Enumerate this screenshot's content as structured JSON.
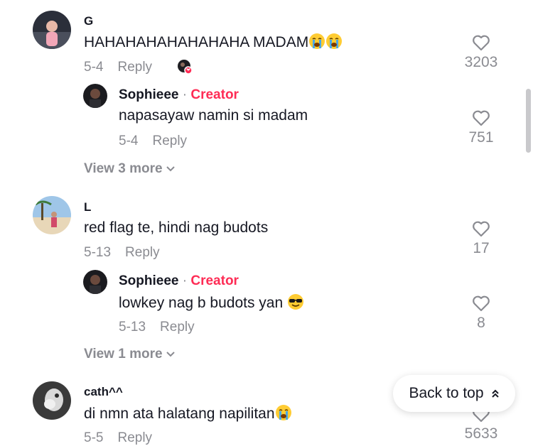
{
  "comments": [
    {
      "username": "G",
      "text": "HAHAHAHAHAHAHAHA MADAM",
      "date": "5-4",
      "reply_label": "Reply",
      "likes": "3203",
      "reply": {
        "username": "Sophieee",
        "separator": "·",
        "creator_label": "Creator",
        "text": "napasayaw namin si madam",
        "date": "5-4",
        "reply_label": "Reply",
        "likes": "751"
      },
      "more_label": "View 3 more"
    },
    {
      "username": "L",
      "text": "red flag te, hindi nag budots",
      "date": "5-13",
      "reply_label": "Reply",
      "likes": "17",
      "reply": {
        "username": "Sophieee",
        "separator": "·",
        "creator_label": "Creator",
        "text": "lowkey nag b budots yan",
        "date": "5-13",
        "reply_label": "Reply",
        "likes": "8"
      },
      "more_label": "View 1 more"
    },
    {
      "username": "cath^^",
      "text": "di nmn ata halatang napilitan",
      "date": "5-5",
      "reply_label": "Reply",
      "likes": "5633"
    }
  ],
  "back_to_top_label": "Back to top",
  "colors": {
    "creator": "#fe2c55",
    "muted": "#8a8b91",
    "text": "#161823"
  },
  "icons": [
    "heart-icon",
    "chevron-down-icon",
    "loudly-crying-face-emoji",
    "sunglasses-face-emoji",
    "double-chevron-up-icon"
  ]
}
